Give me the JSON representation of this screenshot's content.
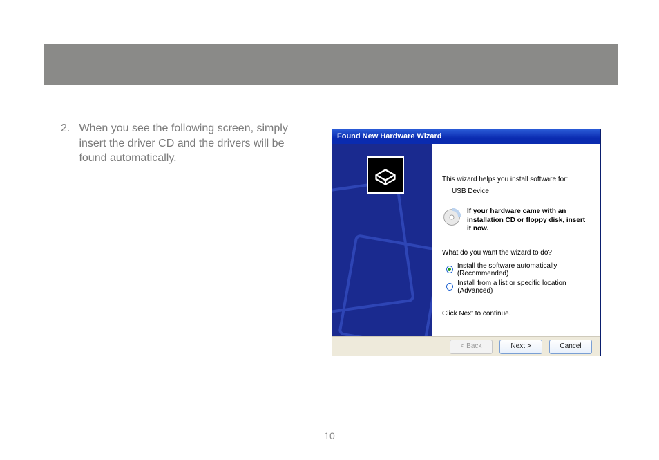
{
  "header_bar": "",
  "instruction": {
    "number": "2.",
    "text": "When you see the following screen, simply insert the driver CD and the drivers will be found automatically."
  },
  "page_number": "10",
  "wizard": {
    "title": "Found New Hardware Wizard",
    "intro": "This wizard helps you install software for:",
    "device": "USB Device",
    "cd_hint": "If your hardware came with an installation CD or floppy disk, insert it now.",
    "prompt": "What do you want the wizard to do?",
    "options": [
      {
        "label": "Install the software automatically (Recommended)",
        "checked": true
      },
      {
        "label": "Install from a list or specific location (Advanced)",
        "checked": false
      }
    ],
    "next_note": "Click Next to continue.",
    "buttons": {
      "back": "< Back",
      "next": "Next >",
      "cancel": "Cancel"
    }
  }
}
